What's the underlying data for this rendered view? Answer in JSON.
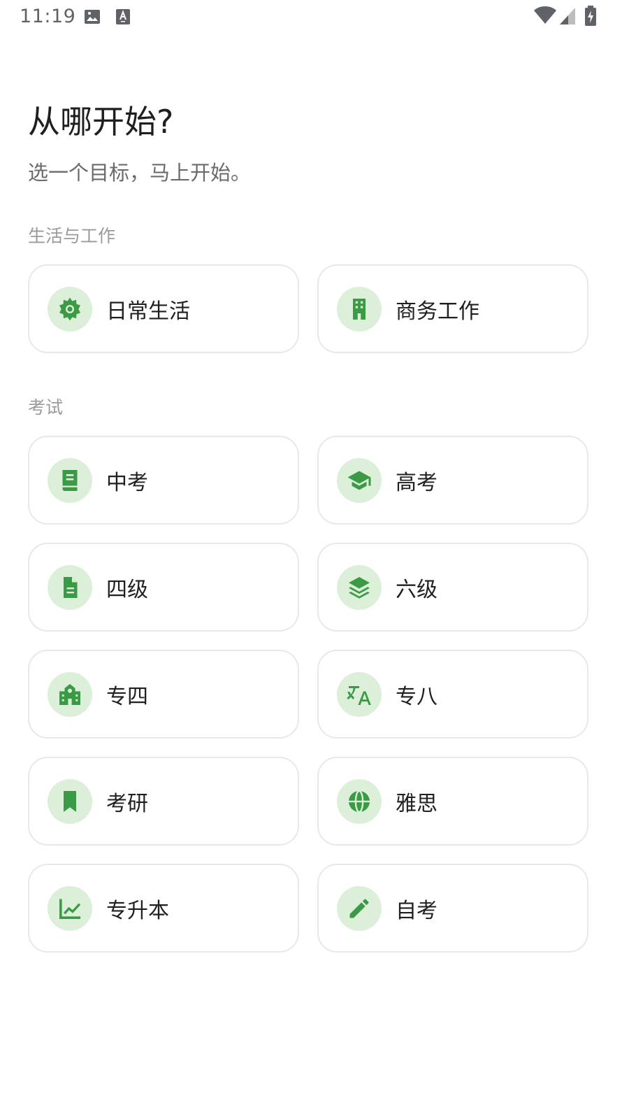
{
  "status_bar": {
    "time": "11:19",
    "left_icons": [
      "image-icon",
      "font-a-icon"
    ],
    "right_icons": [
      "wifi-icon",
      "signal-icon",
      "battery-charging-icon"
    ]
  },
  "header": {
    "title": "从哪开始?",
    "subtitle": "选一个目标，马上开始。"
  },
  "sections": [
    {
      "label": "生活与工作",
      "items": [
        {
          "label": "日常生活",
          "icon": "sun-icon"
        },
        {
          "label": "商务工作",
          "icon": "building-icon"
        }
      ]
    },
    {
      "label": "考试",
      "items": [
        {
          "label": "中考",
          "icon": "book-icon"
        },
        {
          "label": "高考",
          "icon": "graduation-cap-icon"
        },
        {
          "label": "四级",
          "icon": "document-icon"
        },
        {
          "label": "六级",
          "icon": "layers-icon"
        },
        {
          "label": "专四",
          "icon": "school-icon"
        },
        {
          "label": "专八",
          "icon": "translate-icon"
        },
        {
          "label": "考研",
          "icon": "bookmark-icon"
        },
        {
          "label": "雅思",
          "icon": "globe-icon"
        },
        {
          "label": "专升本",
          "icon": "chart-icon"
        },
        {
          "label": "自考",
          "icon": "pencil-icon"
        }
      ]
    }
  ],
  "colors": {
    "accent": "#3a9a45",
    "icon_bg": "#dcefd9",
    "card_border": "#e8e8e8",
    "section_label": "#9a9a9a"
  }
}
